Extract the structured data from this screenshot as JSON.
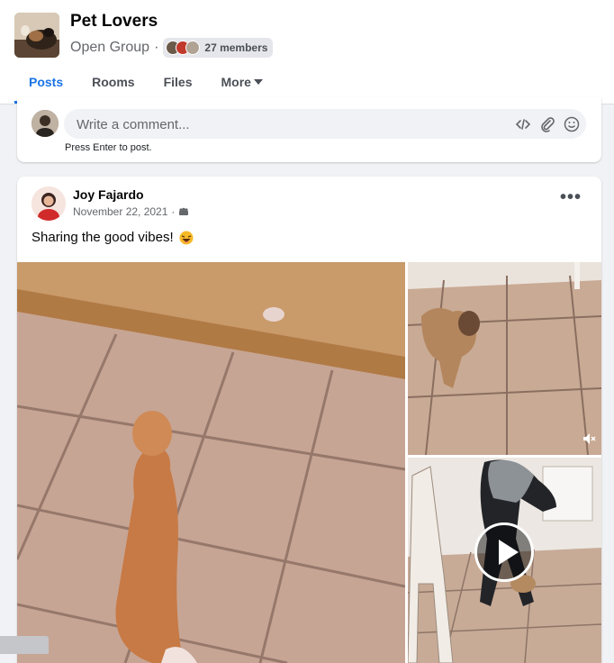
{
  "group": {
    "name": "Pet Lovers",
    "privacy": "Open Group",
    "separator": "·",
    "members_label": "27 members"
  },
  "tabs": [
    {
      "label": "Posts",
      "active": true
    },
    {
      "label": "Rooms",
      "active": false
    },
    {
      "label": "Files",
      "active": false
    },
    {
      "label": "More",
      "active": false
    }
  ],
  "comment": {
    "placeholder": "Write a comment...",
    "hint": "Press Enter to post.",
    "icons": [
      "code-icon",
      "attach-icon",
      "emoji-icon"
    ]
  },
  "post": {
    "author": "Joy Fajardo",
    "date": "November 22, 2021",
    "separator": "·",
    "audience_icon": "group-audience-icon",
    "text": "Sharing the good vibes!",
    "emoji": "laughing-face-emoji",
    "media": [
      {
        "kind": "photo",
        "subject": "cat on tile floor"
      },
      {
        "kind": "video",
        "subject": "dog on tile floor",
        "muted": true
      },
      {
        "kind": "video",
        "subject": "person and dog at door",
        "play": true
      }
    ]
  },
  "colors": {
    "accent": "#1b74e4",
    "background": "#f0f2f5",
    "card": "#ffffff",
    "secondary_text": "#65676b"
  }
}
